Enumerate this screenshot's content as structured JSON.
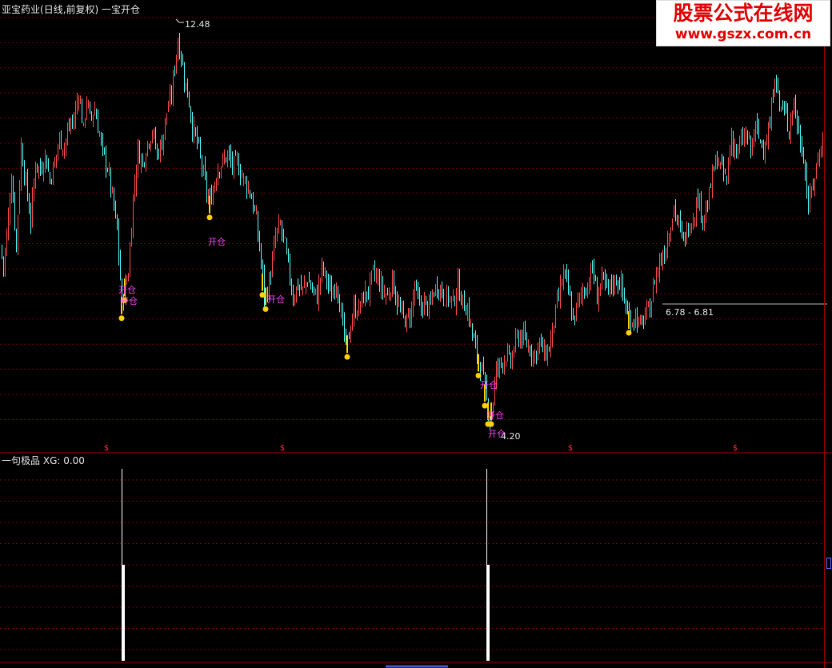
{
  "title_bar": {
    "stock_name": "亚宝药业",
    "period_info": "(日线,前复权)",
    "formula_name": "一宝开仓"
  },
  "indicator_bar": {
    "name": "一句极品",
    "value_text": "XG: 0.00"
  },
  "watermark": {
    "title": "股票公式在线网",
    "url": "www.gszx.com.cn"
  },
  "colors": {
    "up_candle": "#ff4d4d",
    "down_candle": "#54ffff",
    "signal_text": "#ff44ff",
    "signal_bar": "#ffd200",
    "grid": "#7a0000",
    "axis": "#a00000",
    "label": "#e6e6e6",
    "bar": "#ffffff",
    "cursor_line": "#bdbdbd"
  },
  "chart_data": [
    {
      "type": "candlestick",
      "title": "亚宝药业(日线,前复权) 一宝开仓",
      "y_axis_scale": "log",
      "ylim": [
        4.05,
        13.0
      ],
      "annotations": {
        "max_label": "12.48",
        "min_label": "4.20",
        "cursor_label": "6.78 - 6.81",
        "signal_text": "开仓",
        "dividend_marker": "$"
      },
      "close_path_anchors": [
        [
          0,
          6.9
        ],
        [
          4,
          6.5
        ],
        [
          8,
          7.1
        ],
        [
          14,
          8.4
        ],
        [
          20,
          6.9
        ],
        [
          26,
          9.1
        ],
        [
          32,
          8.2
        ],
        [
          38,
          7.4
        ],
        [
          44,
          8.7
        ],
        [
          50,
          8.5
        ],
        [
          56,
          8.9
        ],
        [
          62,
          8.3
        ],
        [
          68,
          8.7
        ],
        [
          74,
          9.3
        ],
        [
          80,
          9.1
        ],
        [
          86,
          9.6
        ],
        [
          92,
          9.8
        ],
        [
          98,
          10.6
        ],
        [
          104,
          9.5
        ],
        [
          108,
          10.4
        ],
        [
          112,
          9.8
        ],
        [
          118,
          10.1
        ],
        [
          124,
          9.4
        ],
        [
          128,
          8.9
        ],
        [
          134,
          8.6
        ],
        [
          140,
          7.9
        ],
        [
          146,
          7.2
        ],
        [
          152,
          5.9
        ],
        [
          156,
          6.2
        ],
        [
          160,
          6.4
        ],
        [
          166,
          7.9
        ],
        [
          172,
          9.0
        ],
        [
          178,
          8.7
        ],
        [
          184,
          9.2
        ],
        [
          190,
          9.5
        ],
        [
          196,
          8.9
        ],
        [
          202,
          9.2
        ],
        [
          208,
          10.0
        ],
        [
          214,
          10.5
        ],
        [
          218,
          11.4
        ],
        [
          222,
          12.2
        ],
        [
          226,
          11.7
        ],
        [
          230,
          11.0
        ],
        [
          236,
          10.3
        ],
        [
          240,
          9.6
        ],
        [
          246,
          9.2
        ],
        [
          252,
          8.6
        ],
        [
          258,
          8.0
        ],
        [
          262,
          7.8
        ],
        [
          266,
          8.1
        ],
        [
          272,
          8.6
        ],
        [
          278,
          8.7
        ],
        [
          284,
          8.9
        ],
        [
          290,
          8.6
        ],
        [
          296,
          8.7
        ],
        [
          302,
          8.4
        ],
        [
          308,
          8.2
        ],
        [
          314,
          7.9
        ],
        [
          320,
          7.4
        ],
        [
          326,
          6.6
        ],
        [
          330,
          6.0
        ],
        [
          334,
          6.1
        ],
        [
          340,
          6.6
        ],
        [
          344,
          7.1
        ],
        [
          350,
          7.3
        ],
        [
          356,
          6.9
        ],
        [
          360,
          6.5
        ],
        [
          366,
          6.0
        ],
        [
          372,
          6.2
        ],
        [
          378,
          6.1
        ],
        [
          384,
          6.3
        ],
        [
          390,
          6.1
        ],
        [
          396,
          6.0
        ],
        [
          402,
          6.5
        ],
        [
          408,
          6.3
        ],
        [
          414,
          6.0
        ],
        [
          420,
          6.3
        ],
        [
          426,
          5.7
        ],
        [
          432,
          5.2
        ],
        [
          436,
          5.4
        ],
        [
          442,
          5.8
        ],
        [
          448,
          5.8
        ],
        [
          454,
          6.0
        ],
        [
          460,
          6.1
        ],
        [
          466,
          6.4
        ],
        [
          472,
          6.3
        ],
        [
          478,
          6.1
        ],
        [
          484,
          6.0
        ],
        [
          490,
          6.3
        ],
        [
          496,
          5.9
        ],
        [
          502,
          5.7
        ],
        [
          508,
          5.6
        ],
        [
          514,
          5.8
        ],
        [
          518,
          6.2
        ],
        [
          524,
          5.8
        ],
        [
          530,
          5.9
        ],
        [
          536,
          5.8
        ],
        [
          542,
          6.1
        ],
        [
          548,
          6.2
        ],
        [
          554,
          6.0
        ],
        [
          560,
          6.0
        ],
        [
          566,
          5.9
        ],
        [
          572,
          6.2
        ],
        [
          578,
          5.9
        ],
        [
          584,
          5.8
        ],
        [
          590,
          5.4
        ],
        [
          596,
          5.1
        ],
        [
          602,
          4.9
        ],
        [
          608,
          4.5
        ],
        [
          612,
          4.3
        ],
        [
          616,
          4.5
        ],
        [
          620,
          4.9
        ],
        [
          626,
          5.0
        ],
        [
          632,
          5.1
        ],
        [
          638,
          5.0
        ],
        [
          644,
          5.3
        ],
        [
          650,
          5.4
        ],
        [
          656,
          5.3
        ],
        [
          662,
          5.2
        ],
        [
          668,
          5.1
        ],
        [
          674,
          5.3
        ],
        [
          680,
          5.1
        ],
        [
          686,
          5.2
        ],
        [
          692,
          5.6
        ],
        [
          698,
          6.0
        ],
        [
          704,
          6.4
        ],
        [
          710,
          6.1
        ],
        [
          716,
          5.6
        ],
        [
          722,
          5.9
        ],
        [
          728,
          6.1
        ],
        [
          734,
          6.2
        ],
        [
          740,
          6.5
        ],
        [
          746,
          6.0
        ],
        [
          752,
          6.3
        ],
        [
          758,
          6.1
        ],
        [
          764,
          6.2
        ],
        [
          770,
          6.3
        ],
        [
          776,
          6.2
        ],
        [
          782,
          5.8
        ],
        [
          788,
          5.6
        ],
        [
          794,
          5.7
        ],
        [
          800,
          5.5
        ],
        [
          806,
          5.7
        ],
        [
          812,
          5.8
        ],
        [
          818,
          6.3
        ],
        [
          824,
          6.6
        ],
        [
          830,
          6.8
        ],
        [
          836,
          7.2
        ],
        [
          842,
          7.7
        ],
        [
          848,
          7.3
        ],
        [
          854,
          7.0
        ],
        [
          860,
          7.3
        ],
        [
          866,
          7.5
        ],
        [
          872,
          7.9
        ],
        [
          878,
          7.5
        ],
        [
          884,
          7.7
        ],
        [
          890,
          8.4
        ],
        [
          896,
          8.8
        ],
        [
          902,
          8.5
        ],
        [
          908,
          8.3
        ],
        [
          914,
          9.4
        ],
        [
          920,
          8.9
        ],
        [
          926,
          9.2
        ],
        [
          932,
          9.4
        ],
        [
          938,
          9.0
        ],
        [
          944,
          9.6
        ],
        [
          950,
          9.2
        ],
        [
          956,
          9.2
        ],
        [
          962,
          9.6
        ],
        [
          968,
          11.2
        ],
        [
          974,
          10.2
        ],
        [
          980,
          10.0
        ],
        [
          986,
          9.6
        ],
        [
          992,
          10.3
        ],
        [
          998,
          9.4
        ],
        [
          1004,
          8.9
        ],
        [
          1010,
          7.7
        ],
        [
          1016,
          8.2
        ],
        [
          1022,
          8.8
        ],
        [
          1028,
          9.3
        ]
      ]
    },
    {
      "type": "bar",
      "title": "一句极品",
      "series": [
        {
          "name": "XG",
          "values": [
            1,
            1
          ]
        }
      ],
      "x_bar_index": [
        154,
        610
      ],
      "ylim": [
        0,
        1
      ]
    }
  ]
}
